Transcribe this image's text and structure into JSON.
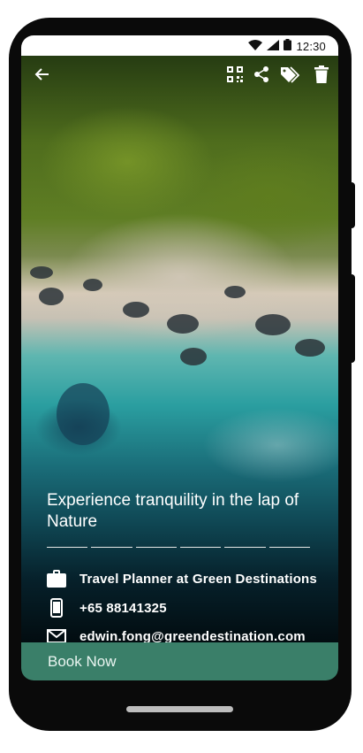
{
  "status_bar": {
    "time": "12:30",
    "icons": [
      "wifi-icon",
      "signal-icon",
      "battery-icon"
    ]
  },
  "top_bar": {
    "back_icon": "arrow-left-icon",
    "actions": [
      "qr-code-icon",
      "share-icon",
      "tags-icon",
      "trash-icon"
    ]
  },
  "hero": {
    "headline": "Experience tranquility in the lap of Nature",
    "progress_segments": 6
  },
  "contact": {
    "job": {
      "icon": "briefcase-icon",
      "text": "Travel Planner at Green Destinations"
    },
    "phone": {
      "icon": "phone-icon",
      "text": "+65 88141325"
    },
    "email": {
      "icon": "mail-icon",
      "text": "edwin.fong@greendestination.com"
    }
  },
  "cta": {
    "label": "Book Now",
    "color": "#3a7f69"
  }
}
